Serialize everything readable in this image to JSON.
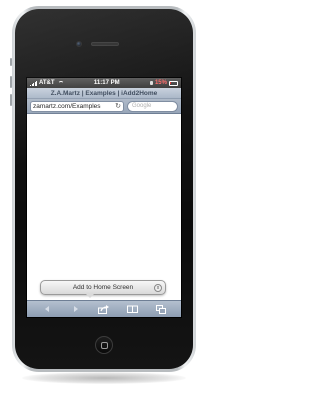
{
  "status_bar": {
    "carrier": "AT&T",
    "time": "11:17 PM",
    "battery_percent": "15%",
    "battery_level": 0.15,
    "signal_icon": "signal-bars-icon",
    "wifi_icon": "wifi-icon",
    "lock_icon": "orientation-lock-icon"
  },
  "browser": {
    "title": "Z.A.Martz | Examples | iAdd2Home",
    "url": "zamartz.com/Examples",
    "search_placeholder": "Google",
    "reload_icon": "reload-icon"
  },
  "add_to_home_popup": {
    "label": "Add to Home Screen",
    "close_label": "x"
  },
  "toolbar": {
    "back_icon": "back-arrow-icon",
    "forward_icon": "forward-arrow-icon",
    "share_icon": "share-icon",
    "bookmarks_icon": "bookmarks-icon",
    "tabs_icon": "tabs-icon"
  },
  "colors": {
    "chrome_blue": "#aab7c8",
    "battery_low": "#e23030",
    "phone_body": "#0b0b0b"
  }
}
